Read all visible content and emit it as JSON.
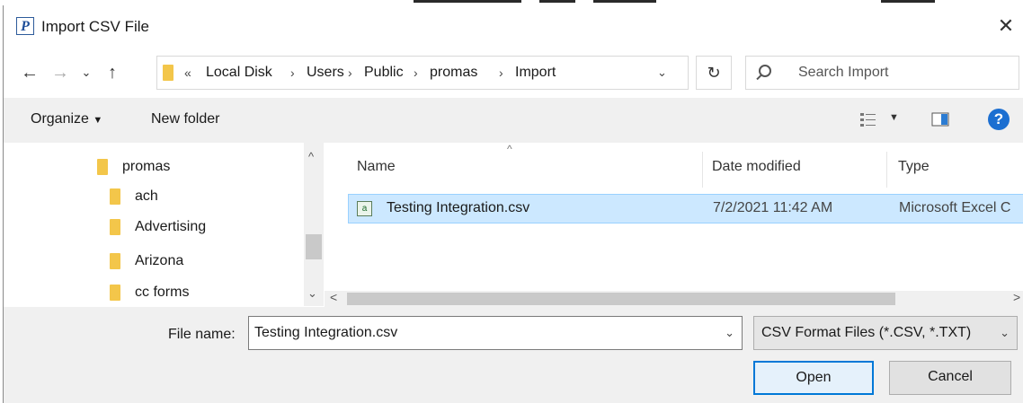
{
  "window": {
    "title": "Import CSV File",
    "close_icon": "close-icon"
  },
  "nav": {
    "path_overflow": "«",
    "breadcrumbs": [
      "Local Disk",
      "Users",
      "Public",
      "promas",
      "Import"
    ],
    "search_placeholder": "Search Import"
  },
  "commandbar": {
    "organize": "Organize",
    "new_folder": "New folder"
  },
  "tree": {
    "items": [
      "promas",
      "ach",
      "Advertising",
      "Arizona",
      "cc forms"
    ]
  },
  "columns": {
    "name": "Name",
    "date_modified": "Date modified",
    "type": "Type"
  },
  "files": [
    {
      "name": "Testing Integration.csv",
      "date": "7/2/2021 11:42 AM",
      "type": "Microsoft Excel C"
    }
  ],
  "bottom": {
    "filename_label": "File name:",
    "filename_value": "Testing Integration.csv",
    "filetype_value": "CSV Format Files (*.CSV, *.TXT)",
    "open": "Open",
    "cancel": "Cancel"
  },
  "colors": {
    "selection": "#cce8ff",
    "accent": "#0078d7",
    "folder": "#f3c64a"
  }
}
